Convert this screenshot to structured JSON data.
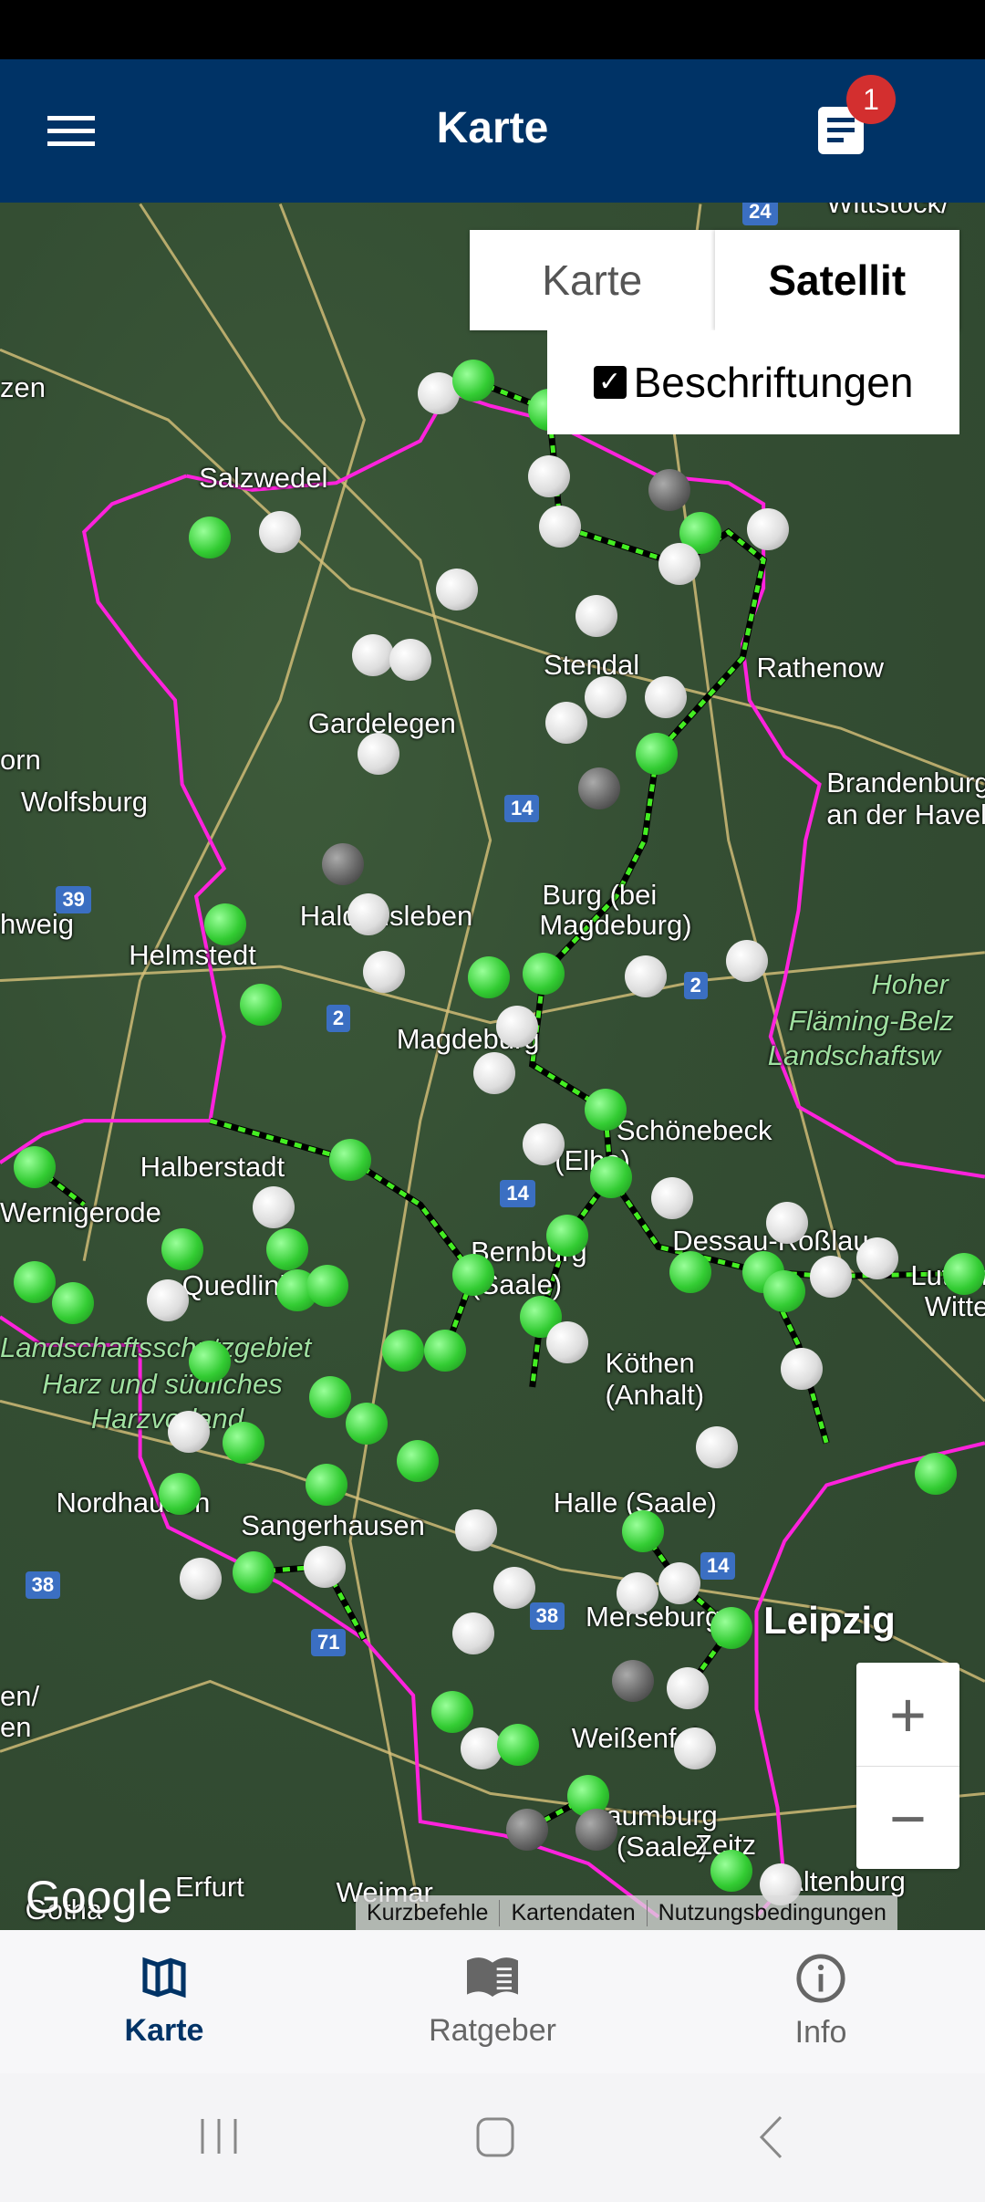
{
  "app_bar": {
    "title": "Karte",
    "menu_icon": "hamburger-menu-icon",
    "notes_icon": "document-icon",
    "badge_count": "1",
    "color": "#003366"
  },
  "map": {
    "type_toggle": {
      "options": [
        "Karte",
        "Satellit"
      ],
      "selected": "Satellit"
    },
    "labels_checkbox": {
      "label": "Beschriftungen",
      "checked": true
    },
    "zoom": {
      "in": "+",
      "out": "−"
    },
    "google_logo": "Google",
    "attribution": [
      "Kurzbefehle",
      "Kartendaten",
      "Nutzungsbedingungen"
    ],
    "places": [
      "Wittstock/",
      "zen",
      "Salzwedel",
      "Stendal",
      "Rathenow",
      "Gardelegen",
      "orn",
      "Wolfsburg",
      "Brandenburg",
      "an der Havel",
      "hweig",
      "Haldensleben",
      "Burg (bei",
      "Magdeburg)",
      "Helmstedt",
      "Magdeburg",
      "Hoher",
      "Fläming-Belz",
      "Landschaftsw",
      "Schönebeck",
      "(Elbe)",
      "Halberstadt",
      "Wernigerode",
      "Quedlinburg",
      "Bernburg",
      "(Saale)",
      "Dessau-Roßlau",
      "Luthers",
      "Wittenb",
      "Köthen",
      "(Anhalt)",
      "Landschaftsschutzgebiet",
      "Harz und südliches",
      "Harzvorland",
      "Nordhausen",
      "Sangerhausen",
      "Halle (Saale)",
      "Leipzig",
      "Merseburg",
      "Weißenfels",
      "Naumburg",
      "(Saale)",
      "Zeitz",
      "Altenburg",
      "Erfurt",
      "Weimar",
      "Gotha",
      "en/",
      "en"
    ],
    "road_shields": [
      "24",
      "14",
      "39",
      "2",
      "2",
      "14",
      "38",
      "71",
      "38",
      "14"
    ],
    "border_color": "#ff22dd",
    "marker_colors": {
      "active": "#33cc33",
      "inactive": "#ffffff",
      "unknown": "#666666"
    }
  },
  "bottom_nav": {
    "items": [
      {
        "label": "Karte",
        "icon": "map-icon",
        "active": true
      },
      {
        "label": "Ratgeber",
        "icon": "book-icon",
        "active": false
      },
      {
        "label": "Info",
        "icon": "info-icon",
        "active": false
      }
    ]
  }
}
